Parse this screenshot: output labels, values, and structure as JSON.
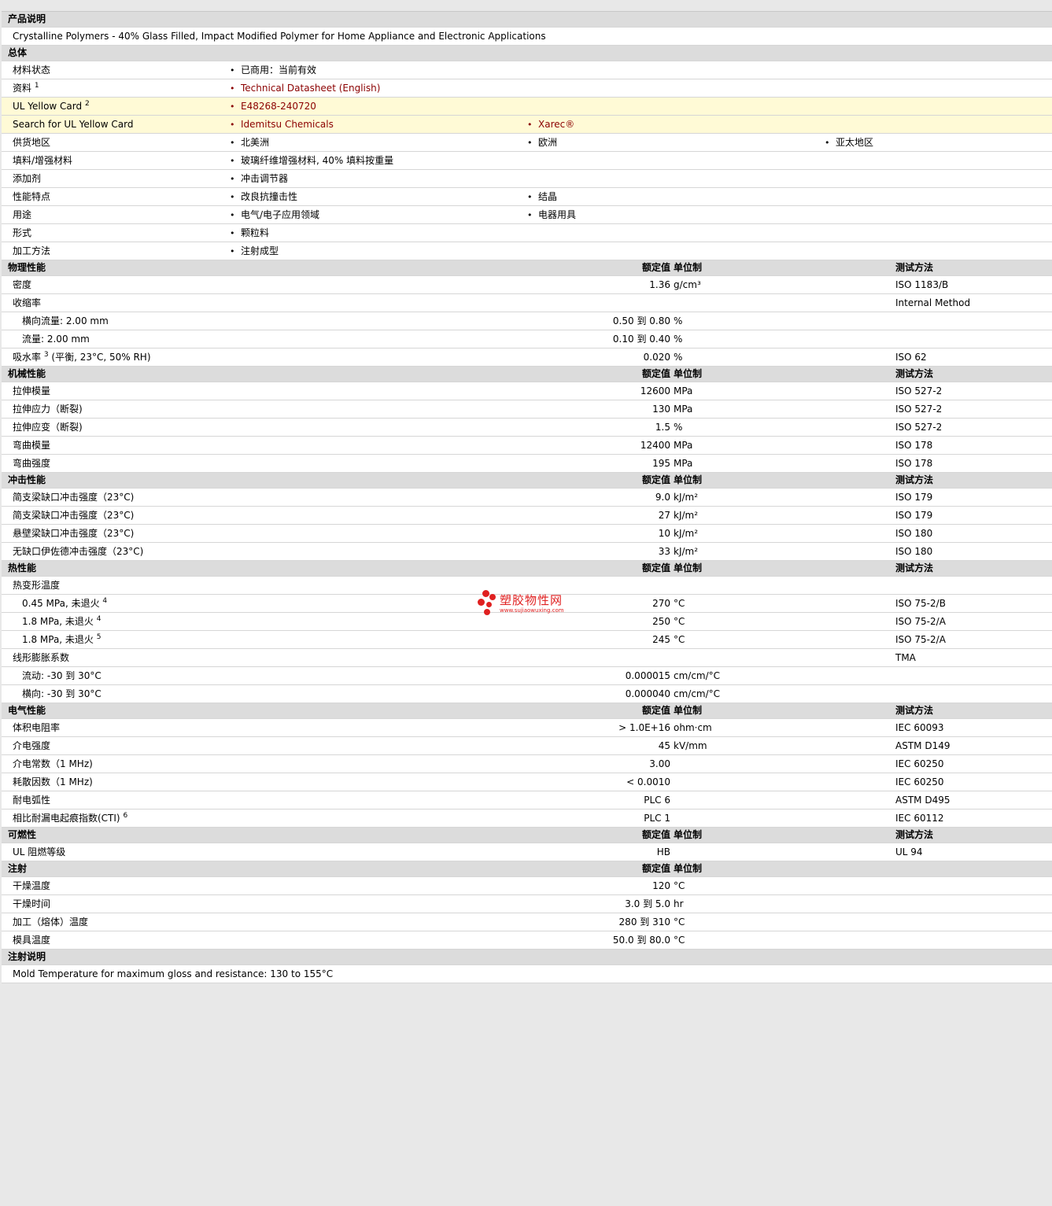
{
  "desc": {
    "title": "产品说明",
    "text": "Crystalline Polymers - 40% Glass Filled, Impact Modified Polymer for Home Appliance and Electronic Applications"
  },
  "general": {
    "title": "总体",
    "rows": [
      {
        "label": "材料状态",
        "b1": "已商用：当前有效"
      },
      {
        "label": "资料",
        "sup": "1",
        "b1": "Technical Datasheet (English)"
      },
      {
        "label": "UL Yellow Card",
        "sup": "2",
        "b1": "E48268-240720"
      },
      {
        "label": "Search for UL Yellow Card",
        "b1": "Idemitsu Chemicals",
        "b2": "Xarec®"
      },
      {
        "label": "供货地区",
        "b1": "北美洲",
        "b2": "欧洲",
        "b3": "亚太地区"
      },
      {
        "label": "填料/增强材料",
        "b1": "玻璃纤维增强材料, 40% 填料按重量"
      },
      {
        "label": "添加剂",
        "b1": "冲击调节器"
      },
      {
        "label": "性能特点",
        "b1": "改良抗撞击性",
        "b2": "结晶"
      },
      {
        "label": "用途",
        "b1": "电气/电子应用领域",
        "b2": "电器用具"
      },
      {
        "label": "形式",
        "b1": "颗粒料"
      },
      {
        "label": "加工方法",
        "b1": "注射成型"
      }
    ]
  },
  "colheads": {
    "value": "额定值",
    "unit": "单位制",
    "method": "测试方法"
  },
  "physical": {
    "title": "物理性能",
    "rows": [
      {
        "label": "密度",
        "value": "1.36",
        "unit": "g/cm³",
        "method": "ISO 1183/B"
      },
      {
        "label": "收缩率",
        "value": "",
        "unit": "",
        "method": "Internal Method"
      },
      {
        "label": "横向流量: 2.00 mm",
        "value": "0.50 到  0.80",
        "unit": "%",
        "method": ""
      },
      {
        "label": "流量: 2.00 mm",
        "value": "0.10 到  0.40",
        "unit": "%",
        "method": ""
      },
      {
        "label": "吸水率",
        "sup": "3",
        "label2": " (平衡, 23°C, 50% RH)",
        "value": "0.020",
        "unit": "%",
        "method": "ISO 62"
      }
    ]
  },
  "mechanical": {
    "title": "机械性能",
    "rows": [
      {
        "label": "拉伸模量",
        "value": "12600",
        "unit": "MPa",
        "method": "ISO 527-2"
      },
      {
        "label": "拉伸应力（断裂)",
        "value": "130",
        "unit": "MPa",
        "method": "ISO 527-2"
      },
      {
        "label": "拉伸应变（断裂)",
        "value": "1.5",
        "unit": "%",
        "method": "ISO 527-2"
      },
      {
        "label": "弯曲模量",
        "value": "12400",
        "unit": "MPa",
        "method": "ISO 178"
      },
      {
        "label": "弯曲强度",
        "value": "195",
        "unit": "MPa",
        "method": "ISO 178"
      }
    ]
  },
  "impact": {
    "title": "冲击性能",
    "rows": [
      {
        "label": "简支梁缺口冲击强度（23°C)",
        "value": "9.0",
        "unit": "kJ/m²",
        "method": "ISO 179"
      },
      {
        "label": "简支梁缺口冲击强度（23°C)",
        "value": "27",
        "unit": "kJ/m²",
        "method": "ISO 179"
      },
      {
        "label": "悬壁梁缺口冲击强度（23°C)",
        "value": "10",
        "unit": "kJ/m²",
        "method": "ISO 180"
      },
      {
        "label": "无缺口伊佐德冲击强度（23°C)",
        "value": "33",
        "unit": "kJ/m²",
        "method": "ISO 180"
      }
    ]
  },
  "thermal": {
    "title": "热性能",
    "rows": [
      {
        "label": "热变形温度",
        "value": "",
        "unit": "",
        "method": ""
      },
      {
        "label": "0.45 MPa, 未退火",
        "sup": "4",
        "value": "270",
        "unit": "°C",
        "method": "ISO 75-2/B"
      },
      {
        "label": "1.8 MPa, 未退火",
        "sup": "4",
        "value": "250",
        "unit": "°C",
        "method": "ISO 75-2/A"
      },
      {
        "label": "1.8 MPa, 未退火",
        "sup": "5",
        "value": "245",
        "unit": "°C",
        "method": "ISO 75-2/A"
      },
      {
        "label": "线形膨胀系数",
        "value": "",
        "unit": "",
        "method": "TMA"
      },
      {
        "label": "流动: -30 到  30°C",
        "value": "0.000015",
        "unit": "cm/cm/°C",
        "method": ""
      },
      {
        "label": "横向: -30 到  30°C",
        "value": "0.000040",
        "unit": "cm/cm/°C",
        "method": ""
      }
    ]
  },
  "electrical": {
    "title": "电气性能",
    "rows": [
      {
        "label": "体积电阻率",
        "value": "> 1.0E+16",
        "unit": "ohm·cm",
        "method": "IEC 60093"
      },
      {
        "label": "介电强度",
        "value": "45",
        "unit": "kV/mm",
        "method": "ASTM D149"
      },
      {
        "label": "介电常数（1 MHz)",
        "value": "3.00",
        "unit": "",
        "method": "IEC 60250"
      },
      {
        "label": "耗散因数（1 MHz)",
        "value": "< 0.0010",
        "unit": "",
        "method": "IEC 60250"
      },
      {
        "label": "耐电弧性",
        "value": "PLC 6",
        "unit": "",
        "method": "ASTM D495"
      },
      {
        "label": "相比耐漏电起痕指数(CTI)",
        "sup": "6",
        "value": "PLC 1",
        "unit": "",
        "method": "IEC 60112"
      }
    ]
  },
  "flammability": {
    "title": "可燃性",
    "rows": [
      {
        "label": "UL 阻燃等级",
        "value": "HB",
        "unit": "",
        "method": "UL 94"
      }
    ]
  },
  "injection": {
    "title": "注射",
    "rows": [
      {
        "label": "干燥温度",
        "value": "120",
        "unit": "°C"
      },
      {
        "label": "干燥时间",
        "value": "3.0 到  5.0",
        "unit": "hr"
      },
      {
        "label": "加工（熔体）温度",
        "value": "280 到  310",
        "unit": "°C"
      },
      {
        "label": "模具温度",
        "value": "50.0 到  80.0",
        "unit": "°C"
      }
    ]
  },
  "injection_note": {
    "title": "注射说明",
    "text": "Mold Temperature for maximum gloss and resistance: 130 to 155°C"
  },
  "watermark": {
    "name": "塑胶物性网",
    "url": "www.sujiaowuxing.com"
  }
}
